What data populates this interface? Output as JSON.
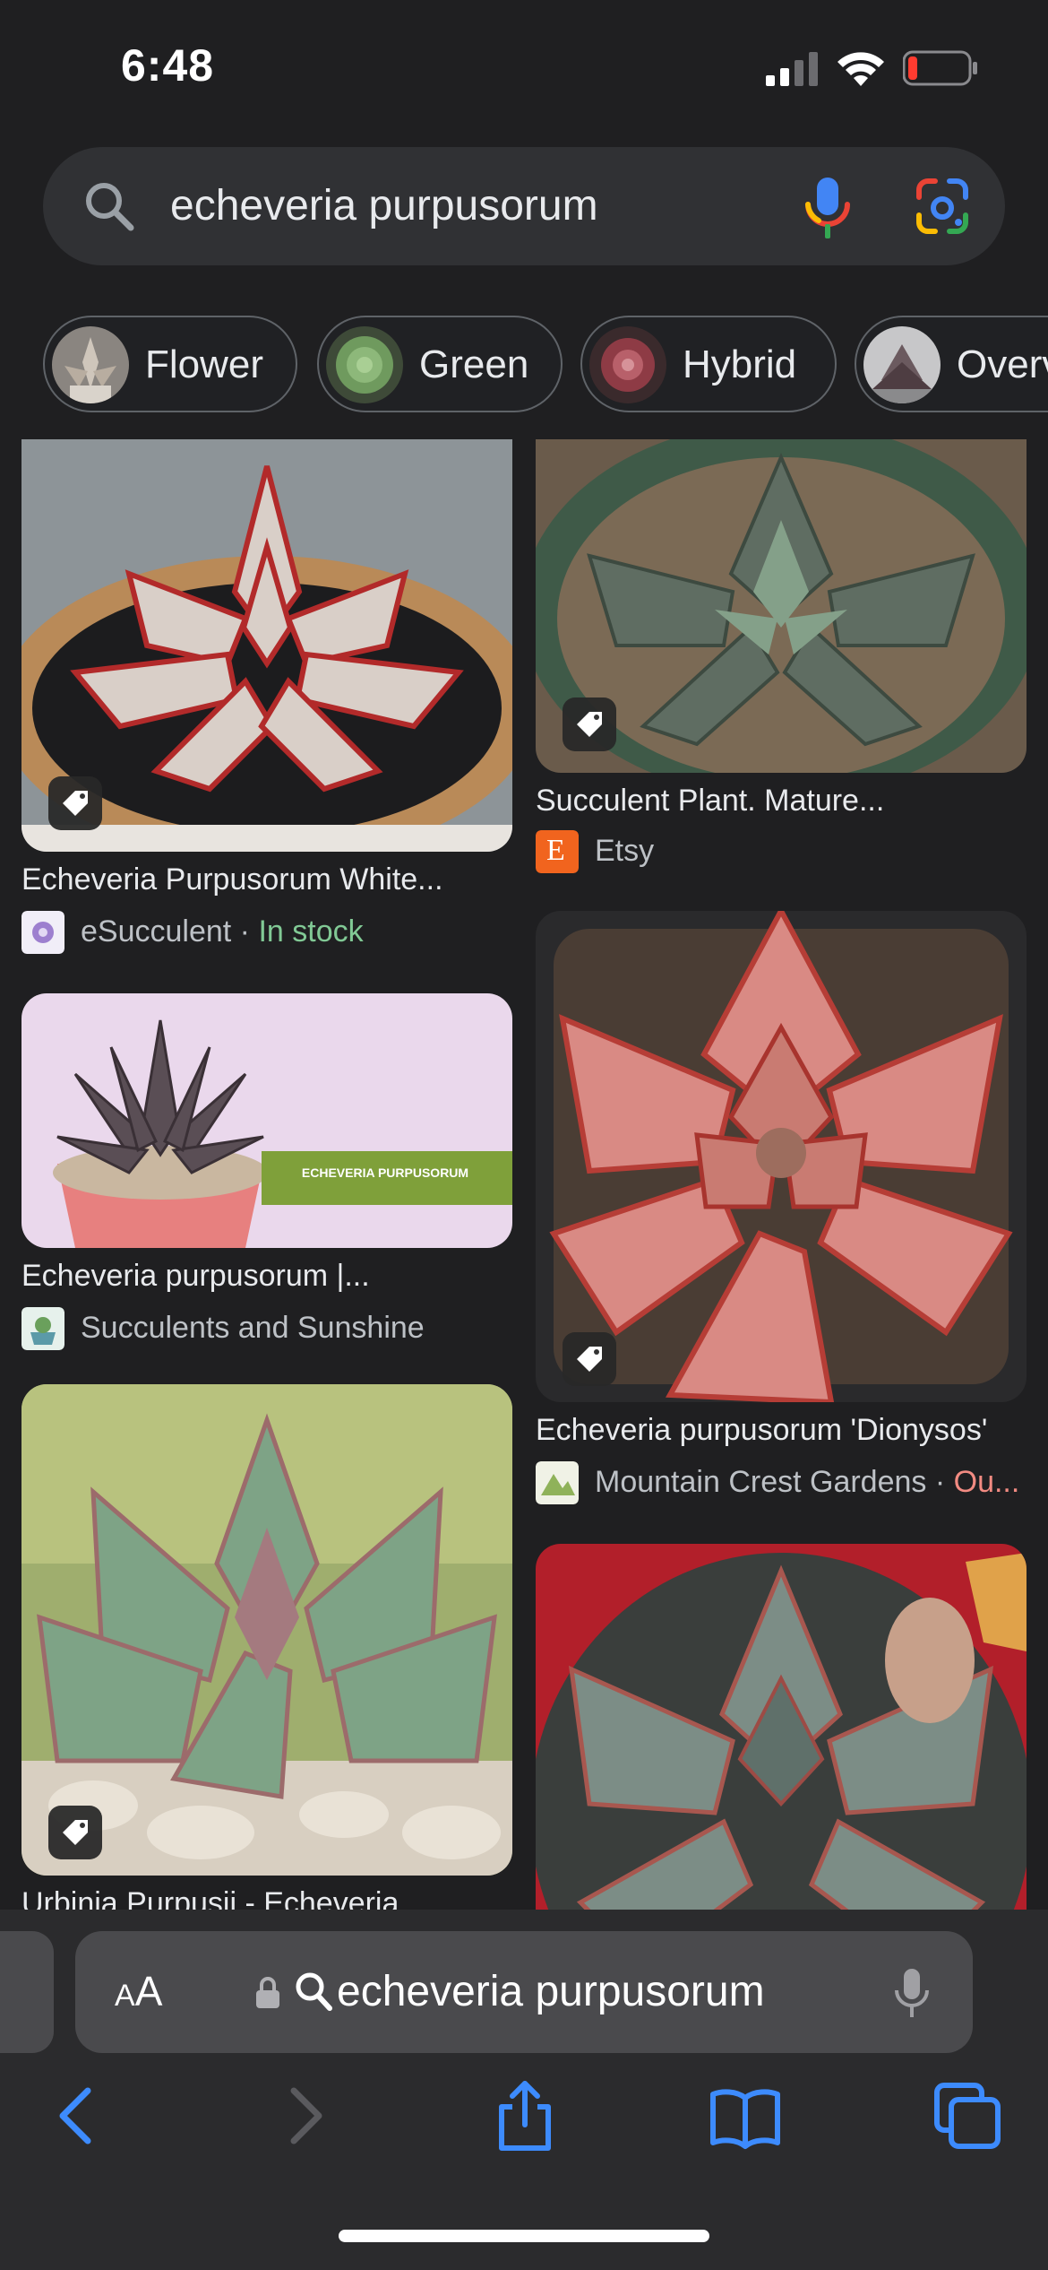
{
  "status": {
    "time": "6:48",
    "icons": [
      "signal-icon",
      "wifi-icon",
      "battery-low-icon"
    ]
  },
  "search": {
    "query": "echeveria purpusorum",
    "icons": [
      "search-icon",
      "voice-search-mic-icon",
      "google-lens-icon"
    ]
  },
  "chips": [
    {
      "label": "Flower"
    },
    {
      "label": "Green"
    },
    {
      "label": "Hybrid"
    },
    {
      "label": "Overv"
    }
  ],
  "results": [
    {
      "title": "Echeveria Purpusorum White...",
      "source": "eSucculent",
      "separator": " · ",
      "status": "In stock"
    },
    {
      "title": "Succulent Plant. Mature...",
      "source": "Etsy",
      "favicon_letter": "E"
    },
    {
      "title": "Echeveria purpusorum |...",
      "source": "Succulents and Sunshine",
      "banner_text": "ECHEVERIA PURPUSORUM"
    },
    {
      "title": "Echeveria purpusorum 'Dionysos'",
      "source": "Mountain Crest Gardens",
      "separator": " · ",
      "status": "Ou..."
    },
    {
      "title": "Urbinia Purpusii - Echeveria...",
      "source": ""
    },
    {
      "title": "",
      "source": ""
    }
  ],
  "safari": {
    "aa_large": "A",
    "aa_small": "A",
    "url_text": "echeveria purpusorum",
    "toolbar": [
      "back-icon",
      "forward-icon",
      "share-icon",
      "bookmarks-icon",
      "tabs-icon"
    ]
  },
  "colors": {
    "background": "#1f1f21",
    "search_bg": "#303134",
    "safari_blue": "#3d8bfd",
    "in_stock_green": "#81c995",
    "out_red": "#f28b82"
  }
}
